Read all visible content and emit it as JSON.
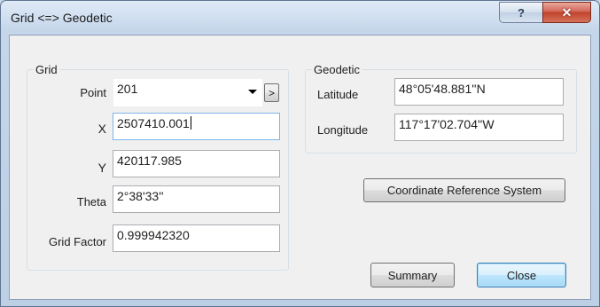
{
  "window": {
    "title": "Grid <=> Geodetic",
    "help_glyph": "?",
    "close_glyph": "✕"
  },
  "grid": {
    "group_label": "Grid",
    "point": {
      "label": "Point",
      "value": "201",
      "next_glyph": ">"
    },
    "x": {
      "label": "X",
      "value": "2507410.001"
    },
    "y": {
      "label": "Y",
      "value": "420117.985"
    },
    "theta": {
      "label": "Theta",
      "value": "2°38'33''"
    },
    "grid_factor": {
      "label": "Grid Factor",
      "value": "0.999942320"
    }
  },
  "geodetic": {
    "group_label": "Geodetic",
    "latitude": {
      "label": "Latitude",
      "value": "48°05'48.881''N"
    },
    "longitude": {
      "label": "Longitude",
      "value": "117°17'02.704''W"
    }
  },
  "buttons": {
    "crs": "Coordinate Reference System",
    "summary": "Summary",
    "close": "Close"
  },
  "colors": {
    "window_frame": "#c5d6ea",
    "client_bg": "#f0f0f0",
    "close_button_red": "#c1432c",
    "focus_border": "#7eb4ea"
  },
  "icons": [
    "help-icon",
    "close-icon",
    "chevron-down-icon",
    "chevron-right-icon"
  ]
}
